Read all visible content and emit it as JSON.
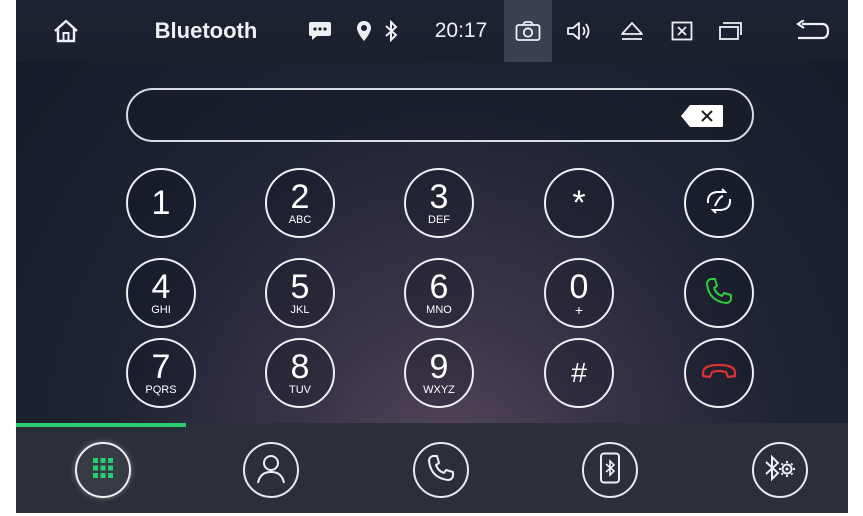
{
  "status_bar": {
    "title": "Bluetooth",
    "time": "20:17",
    "icons": [
      "home-icon",
      "message-icon",
      "location-icon",
      "bluetooth-icon",
      "camera-icon",
      "volume-icon",
      "eject-icon",
      "close-box-icon",
      "windows-icon",
      "back-icon"
    ]
  },
  "dial_field": {
    "value": "",
    "backspace_icon": "backspace-icon"
  },
  "keypad": {
    "keys": [
      {
        "digit": "1",
        "letters": ""
      },
      {
        "digit": "2",
        "letters": "ABC"
      },
      {
        "digit": "3",
        "letters": "DEF"
      },
      {
        "digit": "*",
        "letters": ""
      },
      {
        "digit": "4",
        "letters": "GHI"
      },
      {
        "digit": "5",
        "letters": "JKL"
      },
      {
        "digit": "6",
        "letters": "MNO"
      },
      {
        "digit": "0",
        "letters": "+"
      },
      {
        "digit": "7",
        "letters": "PQRS"
      },
      {
        "digit": "8",
        "letters": "TUV"
      },
      {
        "digit": "9",
        "letters": "WXYZ"
      },
      {
        "digit": "#",
        "letters": ""
      }
    ],
    "actions": [
      "switch-audio-icon",
      "call-icon",
      "hang-up-icon"
    ]
  },
  "bottom_nav": {
    "items": [
      "keypad-icon",
      "contacts-icon",
      "call-log-icon",
      "phone-bluetooth-icon",
      "bluetooth-settings-icon"
    ],
    "active_index": 0
  },
  "colors": {
    "accent_green": "#2ecc71",
    "call_green": "#2ecc40",
    "hangup_red": "#e0332f"
  }
}
